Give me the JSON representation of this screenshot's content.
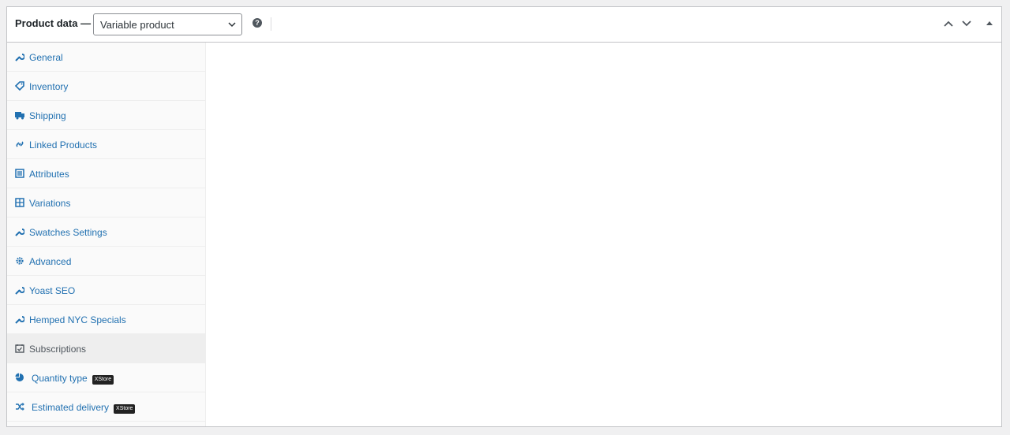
{
  "header": {
    "title": "Product data —",
    "product_type": "Variable product",
    "help_glyph": "?",
    "icons": [
      "chevron-up-icon",
      "chevron-down-icon",
      "collapse-arrow-icon"
    ]
  },
  "tabs": [
    {
      "label": "General",
      "icon": "wrench-icon"
    },
    {
      "label": "Inventory",
      "icon": "tag-icon"
    },
    {
      "label": "Shipping",
      "icon": "truck-icon"
    },
    {
      "label": "Linked Products",
      "icon": "link-icon"
    },
    {
      "label": "Attributes",
      "icon": "list-icon"
    },
    {
      "label": "Variations",
      "icon": "grid-icon"
    },
    {
      "label": "Swatches Settings",
      "icon": "wrench-icon"
    },
    {
      "label": "Advanced",
      "icon": "gear-icon"
    },
    {
      "label": "Yoast SEO",
      "icon": "wrench-icon"
    },
    {
      "label": "Hemped NYC Specials",
      "icon": "wrench-icon"
    },
    {
      "label": "Subscriptions",
      "icon": "calendar-check-icon",
      "active": true
    },
    {
      "label": "Quantity type",
      "icon": "pie-icon",
      "badge": "XStore"
    },
    {
      "label": "Estimated delivery",
      "icon": "shuffle-icon",
      "badge": "XStore"
    }
  ],
  "colors": {
    "link": "#2271b1",
    "active_bg": "#eeeeee",
    "badge_bg": "#222222"
  }
}
